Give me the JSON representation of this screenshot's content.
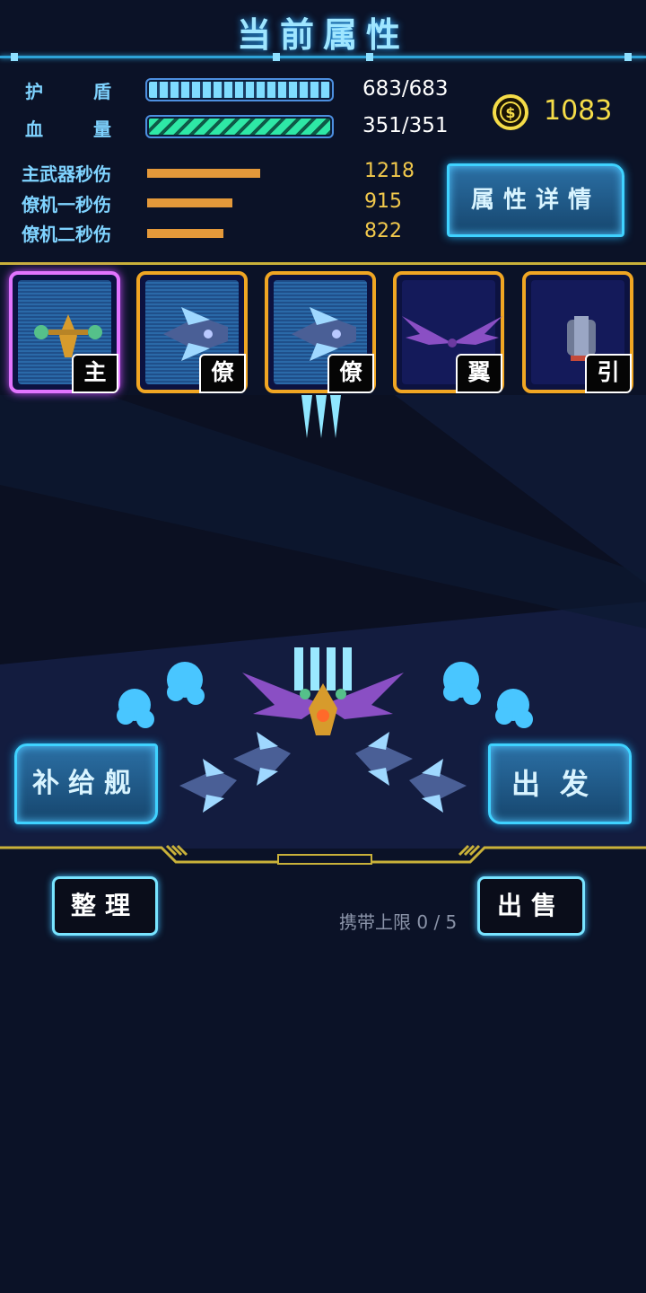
{
  "header": {
    "title": "当前属性"
  },
  "stats": {
    "shield": {
      "label_a": "护",
      "label_b": "盾",
      "value": "683/683",
      "fill": 1.0
    },
    "health": {
      "label_a": "血",
      "label_b": "量",
      "value": "351/351",
      "fill": 1.0
    },
    "coins": "1083"
  },
  "damage": [
    {
      "label": "主武器秒伤",
      "value": "1218",
      "fill": 1.0
    },
    {
      "label": "僚机一秒伤",
      "value": "915",
      "fill": 0.75
    },
    {
      "label": "僚机二秒伤",
      "value": "822",
      "fill": 0.68
    }
  ],
  "buttons": {
    "details": "属性详情",
    "supply": "补给舰",
    "launch": "出发",
    "organize": "整理",
    "sell": "出售"
  },
  "slots": [
    {
      "tag": "主",
      "icon": "main-ship-icon"
    },
    {
      "tag": "僚",
      "icon": "wingman-ship-icon"
    },
    {
      "tag": "僚",
      "icon": "wingman-ship-icon"
    },
    {
      "tag": "翼",
      "icon": "wing-icon"
    },
    {
      "tag": "引",
      "icon": "engine-icon"
    }
  ],
  "inventory": {
    "capacity": "携带上限 0 / 5"
  },
  "colors": {
    "accent": "#3fd2ff",
    "gold": "#f5dc48",
    "shield": "#55c8ff",
    "health": "#2ee8a6",
    "damage_bar": "#e4993a"
  }
}
